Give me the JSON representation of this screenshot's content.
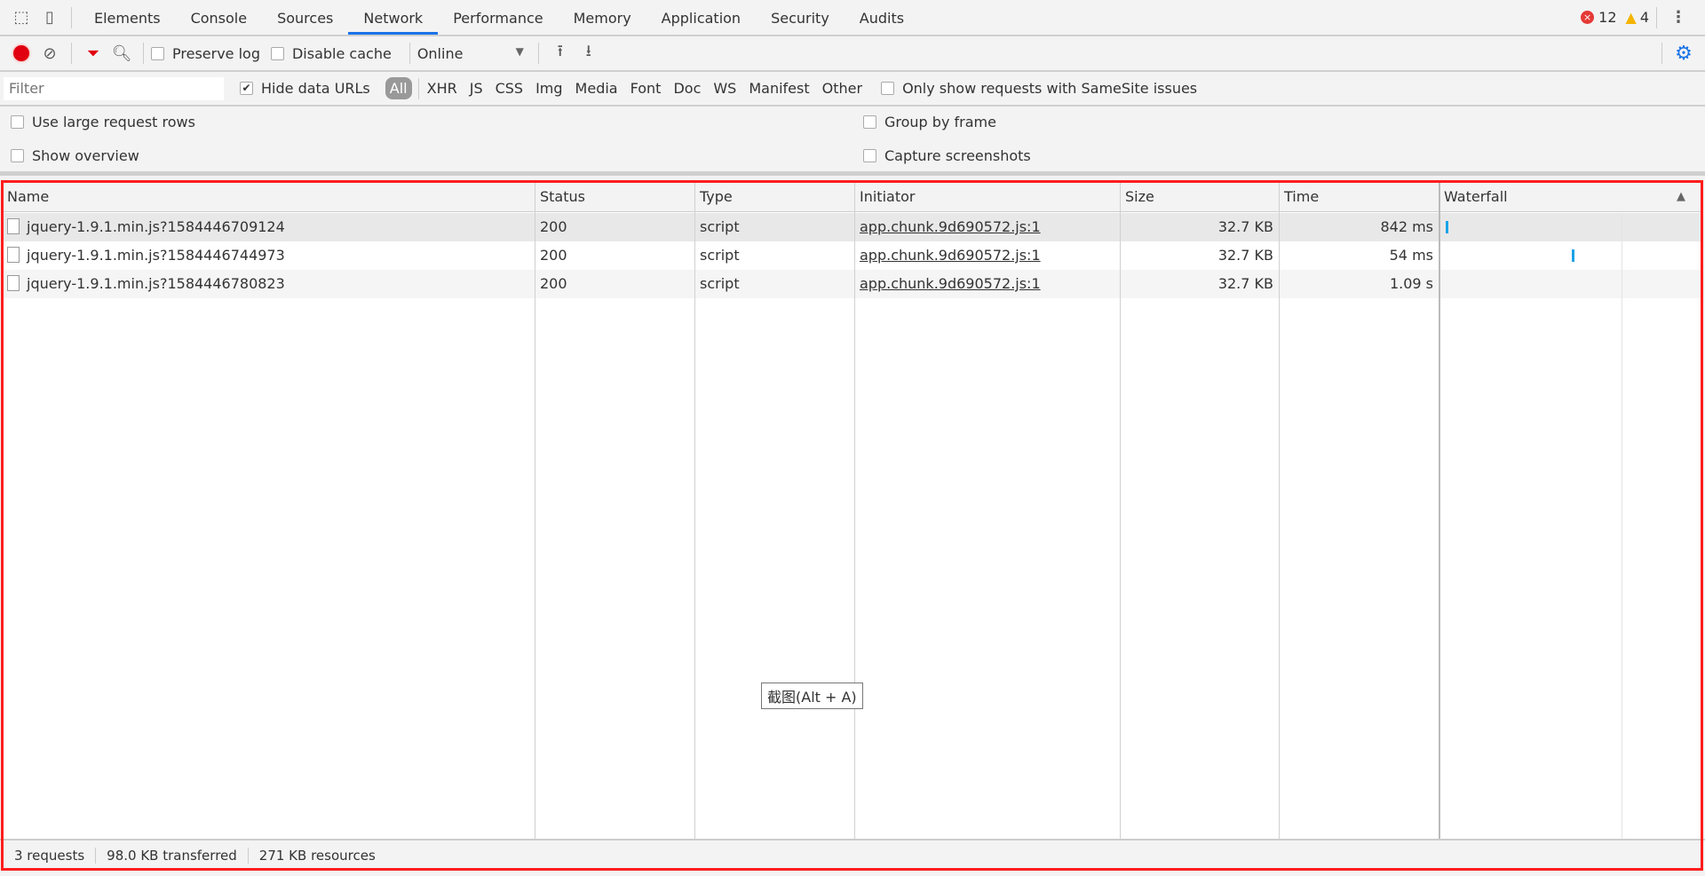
{
  "tabs": [
    "Elements",
    "Console",
    "Sources",
    "Network",
    "Performance",
    "Memory",
    "Application",
    "Security",
    "Audits"
  ],
  "active_tab": "Network",
  "errors": "12",
  "warnings": "4",
  "toolbar": {
    "preserve_log": "Preserve log",
    "disable_cache": "Disable cache",
    "throttle": "Online"
  },
  "filter": {
    "placeholder": "Filter",
    "hide_data_urls": "Hide data URLs",
    "types": [
      "All",
      "XHR",
      "JS",
      "CSS",
      "Img",
      "Media",
      "Font",
      "Doc",
      "WS",
      "Manifest",
      "Other"
    ],
    "samesite": "Only show requests with SameSite issues"
  },
  "settings": {
    "large_rows": "Use large request rows",
    "overview": "Show overview",
    "group_frame": "Group by frame",
    "capture": "Capture screenshots"
  },
  "columns": [
    "Name",
    "Status",
    "Type",
    "Initiator",
    "Size",
    "Time",
    "Waterfall"
  ],
  "rows": [
    {
      "name": "jquery-1.9.1.min.js?1584446709124",
      "status": "200",
      "type": "script",
      "initiator": "app.chunk.9d690572.js:1",
      "size": "32.7 KB",
      "time": "842 ms"
    },
    {
      "name": "jquery-1.9.1.min.js?1584446744973",
      "status": "200",
      "type": "script",
      "initiator": "app.chunk.9d690572.js:1",
      "size": "32.7 KB",
      "time": "54 ms"
    },
    {
      "name": "jquery-1.9.1.min.js?1584446780823",
      "status": "200",
      "type": "script",
      "initiator": "app.chunk.9d690572.js:1",
      "size": "32.7 KB",
      "time": "1.09 s"
    }
  ],
  "footer": {
    "requests": "3 requests",
    "transferred": "98.0 KB transferred",
    "resources": "271 KB resources"
  },
  "tooltip": "截图(Alt + A)",
  "colors": {
    "accent": "#1a73e8",
    "record": "#e0000f",
    "highlight": "#ff1d1d",
    "waterfall_bar": "#1aa3e8"
  }
}
